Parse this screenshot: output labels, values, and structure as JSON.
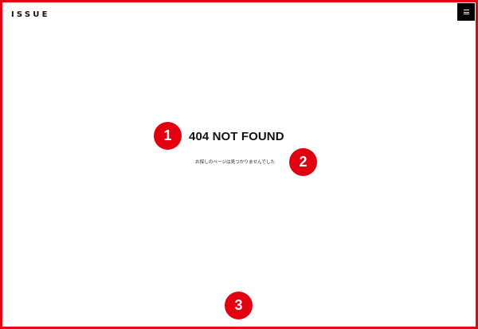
{
  "header": {
    "logo": "ISSUE",
    "menu_icon": "hamburger-menu-icon"
  },
  "main": {
    "heading": "404 NOT FOUND",
    "message": "お探しのページは見つかりませんでした"
  },
  "annotations": {
    "marker_1": "1",
    "marker_2": "2",
    "marker_3": "3"
  },
  "colors": {
    "accent_red": "#e20010",
    "menu_background": "#000000",
    "background": "#ffffff"
  }
}
